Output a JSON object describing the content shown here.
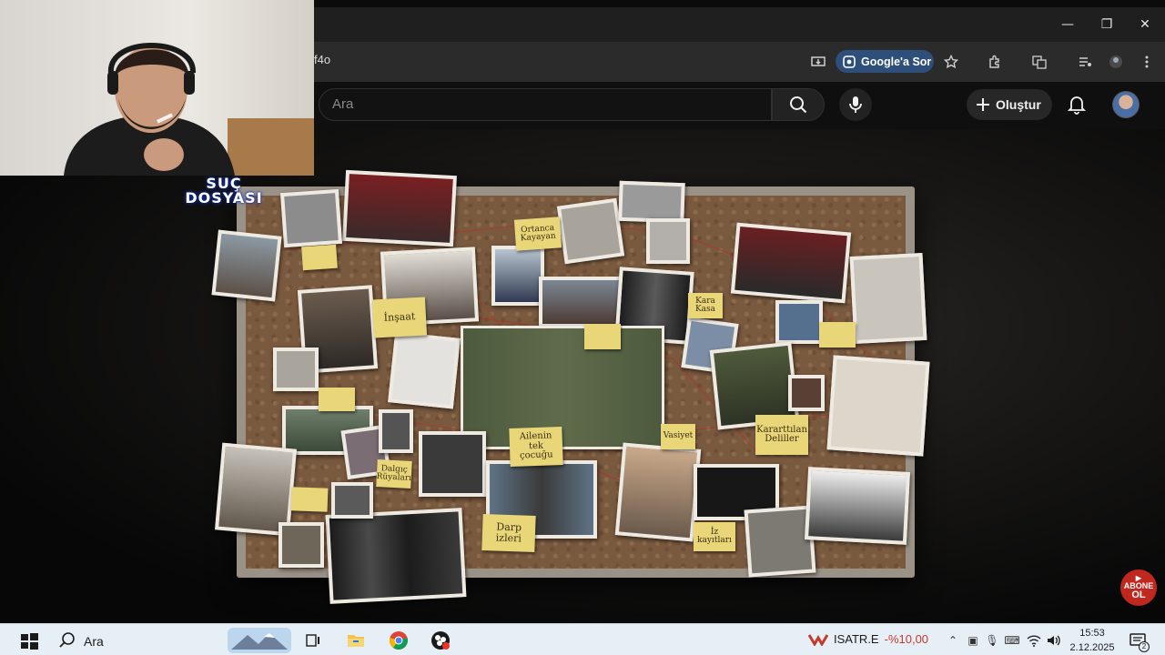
{
  "browser": {
    "url_fragment": "f4o",
    "ask_chip_label": "Google'a Sor",
    "window_controls": [
      "minimize",
      "restore",
      "close"
    ]
  },
  "youtube": {
    "search_placeholder": "Ara",
    "create_label": "Oluştur"
  },
  "video": {
    "logo_line1": "SUÇ",
    "logo_line2": "DOSYASI",
    "subscribe_line1": "ABONE",
    "subscribe_line2": "OL",
    "notes": [
      "Ortanca Kayayan",
      "İnşaat",
      "Ailenin tek çocuğu",
      "Dalgıç Rüyaları",
      "Kararttılan Deliller",
      "Vasiyet",
      "Darp izleri",
      "İz kayıtları",
      "Kara Kasa"
    ]
  },
  "taskbar": {
    "search_placeholder": "Ara",
    "ticker_name": "ISATR.E",
    "ticker_change": "-%10,00",
    "time": "15:53",
    "date": "2.12.2025",
    "notification_count": "2"
  },
  "colors": {
    "chip_bg": "#2e4f7a",
    "taskbar_bg": "#e6eef6",
    "ticker_negative": "#c23a2a",
    "subscribe_red": "#c0271f"
  }
}
